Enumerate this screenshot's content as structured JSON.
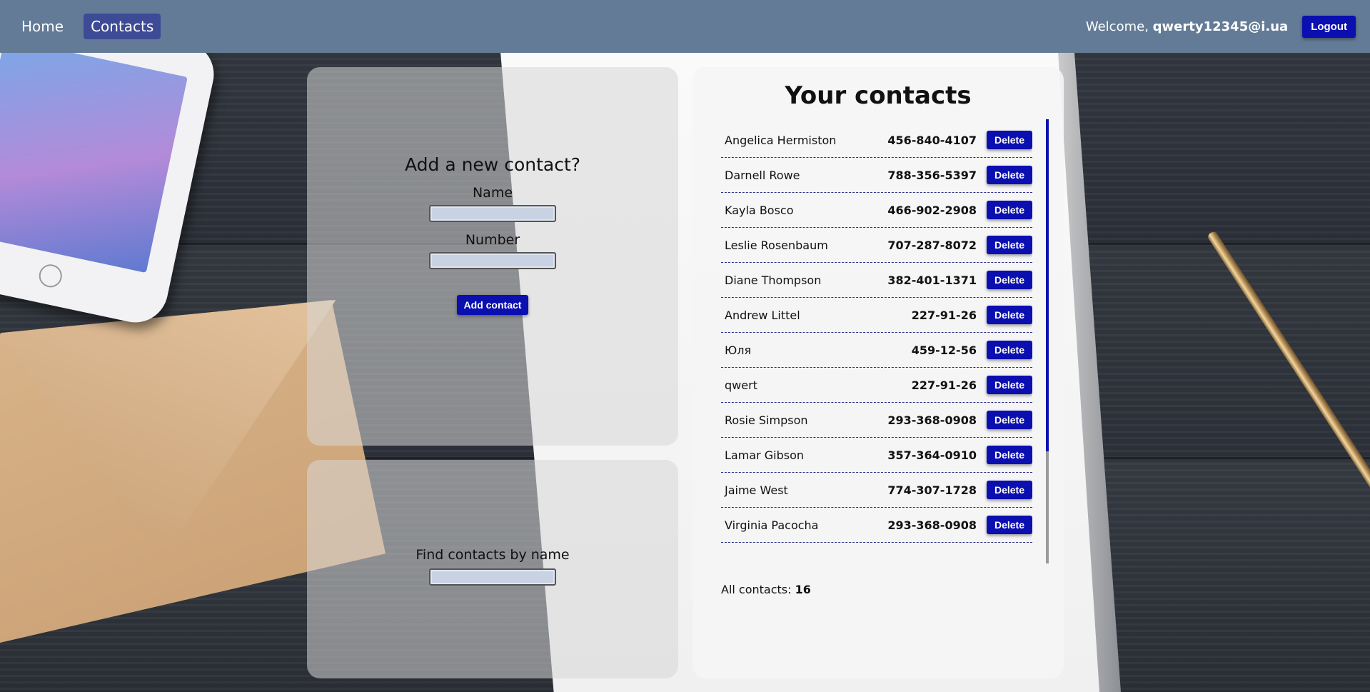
{
  "nav": {
    "home_label": "Home",
    "contacts_label": "Contacts"
  },
  "user": {
    "welcome_prefix": "Welcome,",
    "email": "qwerty12345@i.ua",
    "logout_label": "Logout"
  },
  "form": {
    "title": "Add a new contact?",
    "name_label": "Name",
    "name_value": "",
    "number_label": "Number",
    "number_value": "",
    "submit_label": "Add contact"
  },
  "filter": {
    "label": "Find contacts by name",
    "value": ""
  },
  "contacts": {
    "title": "Your contacts",
    "delete_label": "Delete",
    "items": [
      {
        "name": "Angelica Hermiston",
        "number": "456-840-4107"
      },
      {
        "name": "Darnell Rowe",
        "number": "788-356-5397"
      },
      {
        "name": "Kayla Bosco",
        "number": "466-902-2908"
      },
      {
        "name": "Leslie Rosenbaum",
        "number": "707-287-8072"
      },
      {
        "name": "Diane Thompson",
        "number": "382-401-1371"
      },
      {
        "name": "Andrew Littel",
        "number": "227-91-26"
      },
      {
        "name": "Юля",
        "number": "459-12-56"
      },
      {
        "name": "qwert",
        "number": "227-91-26"
      },
      {
        "name": "Rosie Simpson",
        "number": "293-368-0908"
      },
      {
        "name": "Lamar Gibson",
        "number": "357-364-0910"
      },
      {
        "name": "Jaime West",
        "number": "774-307-1728"
      },
      {
        "name": "Virginia Pacocha",
        "number": "293-368-0908"
      }
    ],
    "total_label": "All contacts:",
    "total_count": "16"
  },
  "colors": {
    "navbar": "#637b96",
    "active_nav": "#3d4b96",
    "button": "#0b0fb0"
  }
}
